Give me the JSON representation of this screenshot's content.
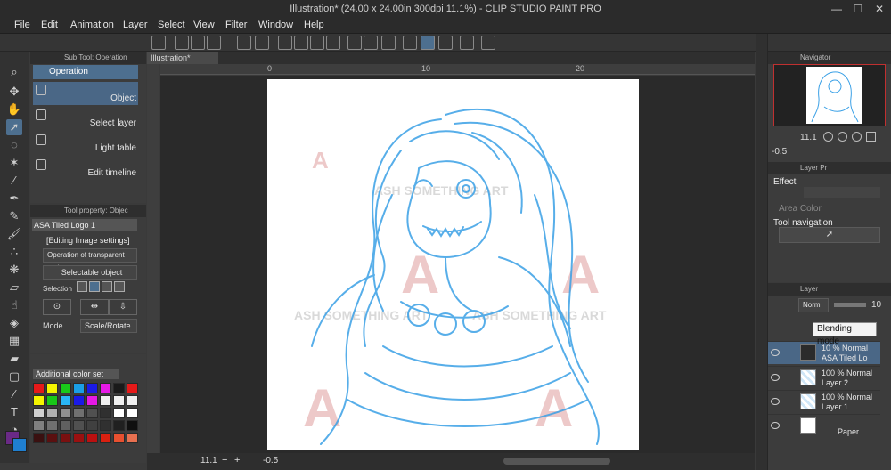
{
  "window": {
    "title": "Illustration* (24.00 x 24.00in 300dpi 11.1%)  - CLIP STUDIO PAINT PRO",
    "minimize": "—",
    "maximize": "☐",
    "close": "✕"
  },
  "menu": [
    "File",
    "Edit",
    "Animation",
    "Layer",
    "Select",
    "View",
    "Filter",
    "Window",
    "Help"
  ],
  "sub_tool": {
    "header": "Sub Tool: Operation",
    "group": "Operation",
    "items": [
      "Object",
      "Select layer",
      "Light table",
      "Edit timeline"
    ]
  },
  "tool_property": {
    "header": "Tool property: Objec",
    "layer_name": "ASA Tiled Logo 1",
    "editing": "[Editing Image settings]",
    "transparent_op": "Operation of transparent part",
    "selectable": "Selectable object",
    "selection_label": "Selection",
    "mode_label": "Mode",
    "mode_value": "Scale/Rotate"
  },
  "color_set": {
    "label": "Additional color set",
    "colors": [
      "#e61919",
      "#f5f500",
      "#19c819",
      "#1a9fe6",
      "#1a1ae6",
      "#e619e6",
      "#1a1a1a",
      "#e61919",
      "#f5f500",
      "#19c819",
      "#29b6f6",
      "#1a1ae6",
      "#e619e6",
      "#f0f0f0",
      "#f0f0f0",
      "#f0f0f0",
      "#d0d0d0",
      "#b0b0b0",
      "#909090",
      "#707070",
      "#505050",
      "#303030",
      "#ffffff",
      "#ffffff",
      "#808080",
      "#707070",
      "#606060",
      "#505050",
      "#404040",
      "#303030",
      "#202020",
      "#101010",
      "#3a1010",
      "#5a1010",
      "#7a1010",
      "#9a1010",
      "#ba1010",
      "#da2010",
      "#e85030",
      "#e87050"
    ]
  },
  "canvas": {
    "tab": "Illustration*",
    "ruler_marks": [
      "0",
      "10",
      "20"
    ],
    "watermark_lines": [
      "ASH SOMETHING ART",
      "ASH SOMETHING ART",
      "ASH SOMETHING ART"
    ],
    "zoom": "11.1",
    "rotate": "-0.5"
  },
  "navigator": {
    "header": "Navigator",
    "zoom": "11.1",
    "rotate": "-0.5"
  },
  "layer_property": {
    "header": "Layer Pr",
    "effect": "Effect",
    "area_color": "Area Color",
    "tool_navigation": "Tool navigation"
  },
  "layer_panel": {
    "header": "Layer",
    "blend_mode": "Norm",
    "opacity": "10",
    "tooltip": "Blending mode",
    "layers": [
      {
        "line1": "10 % Normal",
        "line2": "ASA Tiled Lo",
        "selected": true,
        "thumb": "logo"
      },
      {
        "line1": "100 % Normal",
        "line2": "Layer 2",
        "selected": false,
        "thumb": "chk"
      },
      {
        "line1": "100 % Normal",
        "line2": "Layer 1",
        "selected": false,
        "thumb": "chk"
      },
      {
        "line1": "",
        "line2": "Paper",
        "selected": false,
        "thumb": "paper"
      }
    ]
  },
  "accent": "#4d6f8f",
  "sketch_color": "#3aa0e6"
}
